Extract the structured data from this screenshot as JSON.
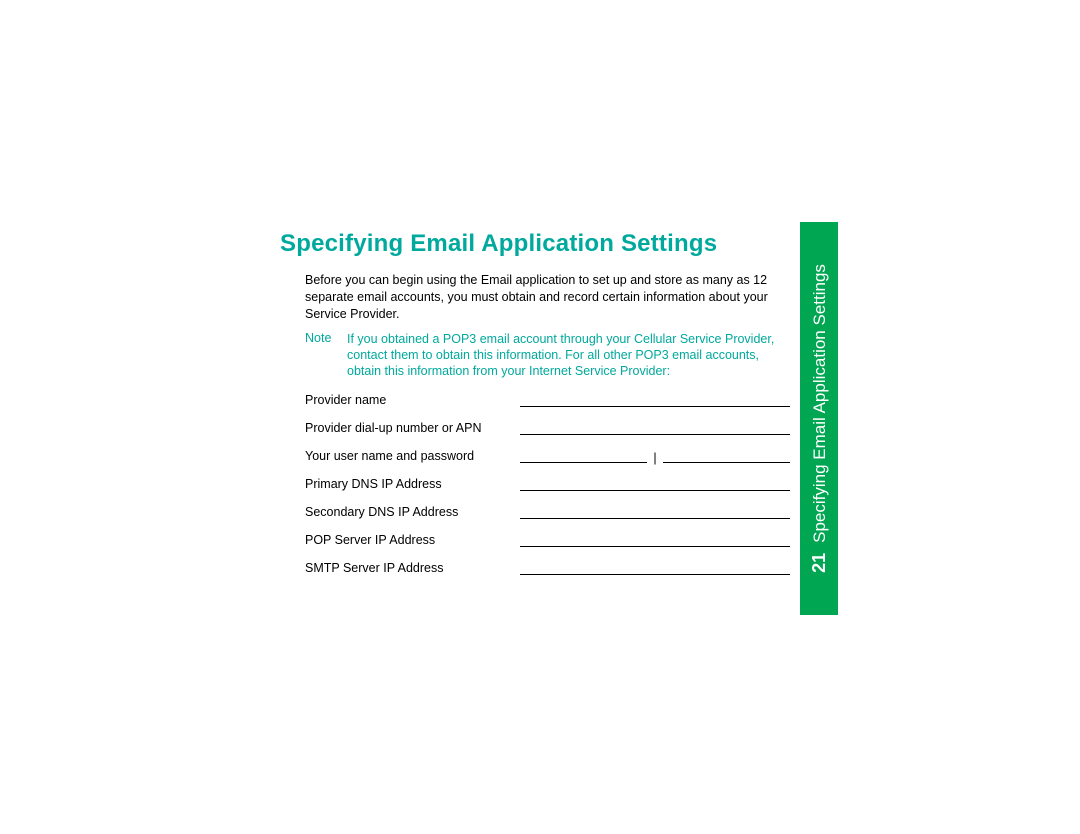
{
  "title": "Specifying Email Application Settings",
  "intro": "Before you can begin using the Email application to set up and store as many as 12 separate email accounts, you must obtain and record certain information about your Service Provider.",
  "note": {
    "label": "Note",
    "text": "If you obtained a POP3 email account through your Cellular Service Provider, contact them to obtain this information. For all other POP3 email accounts, obtain this information from your Internet Service Provider:"
  },
  "form": {
    "rows": [
      {
        "label": "Provider name",
        "split": false
      },
      {
        "label": "Provider dial-up number or APN",
        "split": false
      },
      {
        "label": "Your user name and password",
        "split": true,
        "separator": "|"
      },
      {
        "label": "Primary DNS IP Address",
        "split": false
      },
      {
        "label": "Secondary DNS IP Address",
        "split": false
      },
      {
        "label": "POP Server IP Address",
        "split": false
      },
      {
        "label": "SMTP Server IP Address",
        "split": false
      }
    ]
  },
  "sideTab": {
    "pageNumber": "21",
    "title": "Specifying Email Application Settings"
  }
}
